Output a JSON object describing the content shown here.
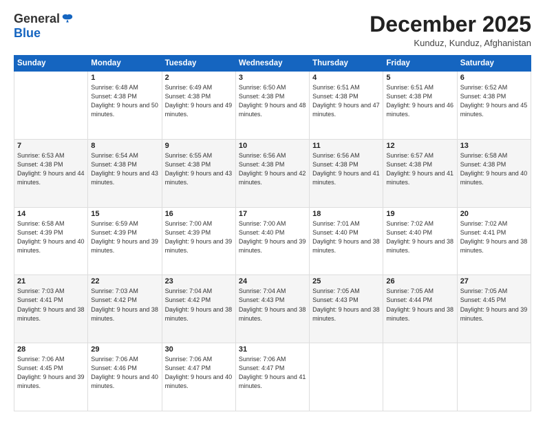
{
  "logo": {
    "general": "General",
    "blue": "Blue"
  },
  "header": {
    "month": "December 2025",
    "location": "Kunduz, Kunduz, Afghanistan"
  },
  "weekdays": [
    "Sunday",
    "Monday",
    "Tuesday",
    "Wednesday",
    "Thursday",
    "Friday",
    "Saturday"
  ],
  "weeks": [
    [
      {
        "day": "",
        "sunrise": "",
        "sunset": "",
        "daylight": ""
      },
      {
        "day": "1",
        "sunrise": "Sunrise: 6:48 AM",
        "sunset": "Sunset: 4:38 PM",
        "daylight": "Daylight: 9 hours and 50 minutes."
      },
      {
        "day": "2",
        "sunrise": "Sunrise: 6:49 AM",
        "sunset": "Sunset: 4:38 PM",
        "daylight": "Daylight: 9 hours and 49 minutes."
      },
      {
        "day": "3",
        "sunrise": "Sunrise: 6:50 AM",
        "sunset": "Sunset: 4:38 PM",
        "daylight": "Daylight: 9 hours and 48 minutes."
      },
      {
        "day": "4",
        "sunrise": "Sunrise: 6:51 AM",
        "sunset": "Sunset: 4:38 PM",
        "daylight": "Daylight: 9 hours and 47 minutes."
      },
      {
        "day": "5",
        "sunrise": "Sunrise: 6:51 AM",
        "sunset": "Sunset: 4:38 PM",
        "daylight": "Daylight: 9 hours and 46 minutes."
      },
      {
        "day": "6",
        "sunrise": "Sunrise: 6:52 AM",
        "sunset": "Sunset: 4:38 PM",
        "daylight": "Daylight: 9 hours and 45 minutes."
      }
    ],
    [
      {
        "day": "7",
        "sunrise": "Sunrise: 6:53 AM",
        "sunset": "Sunset: 4:38 PM",
        "daylight": "Daylight: 9 hours and 44 minutes."
      },
      {
        "day": "8",
        "sunrise": "Sunrise: 6:54 AM",
        "sunset": "Sunset: 4:38 PM",
        "daylight": "Daylight: 9 hours and 43 minutes."
      },
      {
        "day": "9",
        "sunrise": "Sunrise: 6:55 AM",
        "sunset": "Sunset: 4:38 PM",
        "daylight": "Daylight: 9 hours and 43 minutes."
      },
      {
        "day": "10",
        "sunrise": "Sunrise: 6:56 AM",
        "sunset": "Sunset: 4:38 PM",
        "daylight": "Daylight: 9 hours and 42 minutes."
      },
      {
        "day": "11",
        "sunrise": "Sunrise: 6:56 AM",
        "sunset": "Sunset: 4:38 PM",
        "daylight": "Daylight: 9 hours and 41 minutes."
      },
      {
        "day": "12",
        "sunrise": "Sunrise: 6:57 AM",
        "sunset": "Sunset: 4:38 PM",
        "daylight": "Daylight: 9 hours and 41 minutes."
      },
      {
        "day": "13",
        "sunrise": "Sunrise: 6:58 AM",
        "sunset": "Sunset: 4:38 PM",
        "daylight": "Daylight: 9 hours and 40 minutes."
      }
    ],
    [
      {
        "day": "14",
        "sunrise": "Sunrise: 6:58 AM",
        "sunset": "Sunset: 4:39 PM",
        "daylight": "Daylight: 9 hours and 40 minutes."
      },
      {
        "day": "15",
        "sunrise": "Sunrise: 6:59 AM",
        "sunset": "Sunset: 4:39 PM",
        "daylight": "Daylight: 9 hours and 39 minutes."
      },
      {
        "day": "16",
        "sunrise": "Sunrise: 7:00 AM",
        "sunset": "Sunset: 4:39 PM",
        "daylight": "Daylight: 9 hours and 39 minutes."
      },
      {
        "day": "17",
        "sunrise": "Sunrise: 7:00 AM",
        "sunset": "Sunset: 4:40 PM",
        "daylight": "Daylight: 9 hours and 39 minutes."
      },
      {
        "day": "18",
        "sunrise": "Sunrise: 7:01 AM",
        "sunset": "Sunset: 4:40 PM",
        "daylight": "Daylight: 9 hours and 38 minutes."
      },
      {
        "day": "19",
        "sunrise": "Sunrise: 7:02 AM",
        "sunset": "Sunset: 4:40 PM",
        "daylight": "Daylight: 9 hours and 38 minutes."
      },
      {
        "day": "20",
        "sunrise": "Sunrise: 7:02 AM",
        "sunset": "Sunset: 4:41 PM",
        "daylight": "Daylight: 9 hours and 38 minutes."
      }
    ],
    [
      {
        "day": "21",
        "sunrise": "Sunrise: 7:03 AM",
        "sunset": "Sunset: 4:41 PM",
        "daylight": "Daylight: 9 hours and 38 minutes."
      },
      {
        "day": "22",
        "sunrise": "Sunrise: 7:03 AM",
        "sunset": "Sunset: 4:42 PM",
        "daylight": "Daylight: 9 hours and 38 minutes."
      },
      {
        "day": "23",
        "sunrise": "Sunrise: 7:04 AM",
        "sunset": "Sunset: 4:42 PM",
        "daylight": "Daylight: 9 hours and 38 minutes."
      },
      {
        "day": "24",
        "sunrise": "Sunrise: 7:04 AM",
        "sunset": "Sunset: 4:43 PM",
        "daylight": "Daylight: 9 hours and 38 minutes."
      },
      {
        "day": "25",
        "sunrise": "Sunrise: 7:05 AM",
        "sunset": "Sunset: 4:43 PM",
        "daylight": "Daylight: 9 hours and 38 minutes."
      },
      {
        "day": "26",
        "sunrise": "Sunrise: 7:05 AM",
        "sunset": "Sunset: 4:44 PM",
        "daylight": "Daylight: 9 hours and 38 minutes."
      },
      {
        "day": "27",
        "sunrise": "Sunrise: 7:05 AM",
        "sunset": "Sunset: 4:45 PM",
        "daylight": "Daylight: 9 hours and 39 minutes."
      }
    ],
    [
      {
        "day": "28",
        "sunrise": "Sunrise: 7:06 AM",
        "sunset": "Sunset: 4:45 PM",
        "daylight": "Daylight: 9 hours and 39 minutes."
      },
      {
        "day": "29",
        "sunrise": "Sunrise: 7:06 AM",
        "sunset": "Sunset: 4:46 PM",
        "daylight": "Daylight: 9 hours and 40 minutes."
      },
      {
        "day": "30",
        "sunrise": "Sunrise: 7:06 AM",
        "sunset": "Sunset: 4:47 PM",
        "daylight": "Daylight: 9 hours and 40 minutes."
      },
      {
        "day": "31",
        "sunrise": "Sunrise: 7:06 AM",
        "sunset": "Sunset: 4:47 PM",
        "daylight": "Daylight: 9 hours and 41 minutes."
      },
      {
        "day": "",
        "sunrise": "",
        "sunset": "",
        "daylight": ""
      },
      {
        "day": "",
        "sunrise": "",
        "sunset": "",
        "daylight": ""
      },
      {
        "day": "",
        "sunrise": "",
        "sunset": "",
        "daylight": ""
      }
    ]
  ]
}
